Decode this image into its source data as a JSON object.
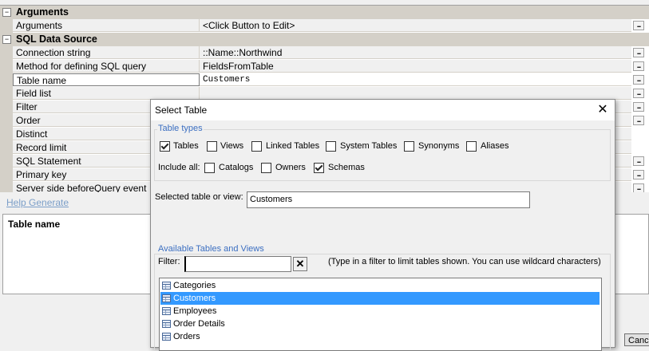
{
  "property_grid": {
    "categories": [
      "Arguments",
      "SQL Data Source"
    ],
    "collapse_glyph": "−",
    "rows": [
      {
        "name": "Arguments",
        "value": "<Click Button to Edit>",
        "button": true
      },
      {
        "name": "Connection string",
        "value": "::Name::Northwind",
        "button": true
      },
      {
        "name": "Method for defining SQL query",
        "value": "FieldsFromTable",
        "button": true
      },
      {
        "name": "Table name",
        "value": "Customers",
        "button": true
      },
      {
        "name": "Field list",
        "value": "",
        "button": true
      },
      {
        "name": "Filter",
        "value": "",
        "button": true
      },
      {
        "name": "Order",
        "value": "",
        "button": true
      },
      {
        "name": "Distinct",
        "value": "",
        "button": false
      },
      {
        "name": "Record limit",
        "value": "",
        "button": false
      },
      {
        "name": "SQL Statement",
        "value": "",
        "button": true
      },
      {
        "name": "Primary key",
        "value": "",
        "button": true
      },
      {
        "name": "Server side beforeQuery event",
        "value": "",
        "button": true
      }
    ],
    "ellipsis": "..."
  },
  "help_link": "Help Generate",
  "description_title": "Table name",
  "bottom_bar": {
    "cancel_label": "Canc"
  },
  "dialog": {
    "title": "Select Table",
    "close_glyph": "✕",
    "table_types": {
      "legend": "Table types",
      "options": [
        {
          "label": "Tables",
          "checked": true
        },
        {
          "label": "Views",
          "checked": false
        },
        {
          "label": "Linked Tables",
          "checked": false
        },
        {
          "label": "System Tables",
          "checked": false
        },
        {
          "label": "Synonyms",
          "checked": false
        },
        {
          "label": "Aliases",
          "checked": false
        }
      ],
      "include_all_label": "Include all:",
      "include_all": [
        {
          "label": "Catalogs",
          "checked": false
        },
        {
          "label": "Owners",
          "checked": false
        },
        {
          "label": "Schemas",
          "checked": true
        }
      ]
    },
    "selected_label": "Selected table or view:",
    "selected_value": "Customers",
    "available": {
      "legend": "Available Tables and Views",
      "filter_label": "Filter:",
      "filter_value": "",
      "clear_glyph": "✕",
      "hint": "(Type in a filter to limit tables shown. You can use wildcard characters)",
      "tables": [
        "Categories",
        "Customers",
        "Employees",
        "Order Details",
        "Orders"
      ],
      "selected_index": 1
    }
  }
}
